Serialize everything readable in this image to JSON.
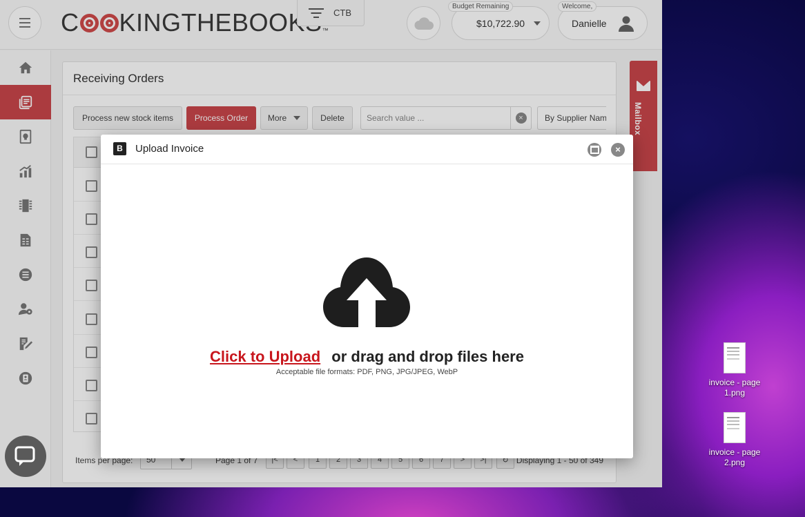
{
  "app": {
    "brand": "COOKINGTHEBOOKS",
    "brand_parts": [
      "C",
      "KINGTHEBOOKS"
    ],
    "brand_tm": "™",
    "store_tab": "CTB",
    "budget_caption": "Budget Remaining",
    "budget_value": "$10,722.90",
    "welcome_caption": "Welcome,",
    "user_name": "Danielle"
  },
  "sidebar": {
    "items": [
      {
        "icon": "home-icon"
      },
      {
        "icon": "orders-icon",
        "active": true
      },
      {
        "icon": "recipe-icon"
      },
      {
        "icon": "reports-icon"
      },
      {
        "icon": "inventory-icon"
      },
      {
        "icon": "invoice-icon"
      },
      {
        "icon": "list-icon"
      },
      {
        "icon": "users-icon"
      },
      {
        "icon": "edit-icon"
      },
      {
        "icon": "contacts-icon"
      }
    ]
  },
  "page": {
    "title": "Receiving Orders",
    "toolbar": {
      "process_new": "Process new stock items",
      "process_order": "Process Order",
      "more": "More",
      "delete": "Delete",
      "search_placeholder": "Search value ...",
      "clear": "×",
      "supplier_filter": "By Supplier Nam"
    },
    "pager": {
      "items_per_page_label": "Items per page:",
      "items_per_page_value": "50",
      "page_label": "Page 1 of 7",
      "pages": [
        "1",
        "2",
        "3",
        "4",
        "5",
        "6",
        "7"
      ],
      "displaying": "Displaying 1 - 50 of 349"
    }
  },
  "mailbox": {
    "label": "Mailbox"
  },
  "dialog": {
    "logo_letter": "B",
    "title": "Upload Invoice",
    "click_to_upload": "Click to Upload",
    "drag_text": "or drag and drop files here",
    "formats": "Acceptable file formats: PDF, PNG, JPG/JPEG, WebP"
  },
  "desktop": {
    "files": [
      {
        "name": "invoice - page 1.png"
      },
      {
        "name": "invoice - page 2.png"
      }
    ]
  },
  "colors": {
    "accent": "#c9464b",
    "upload_link": "#c8161d"
  }
}
